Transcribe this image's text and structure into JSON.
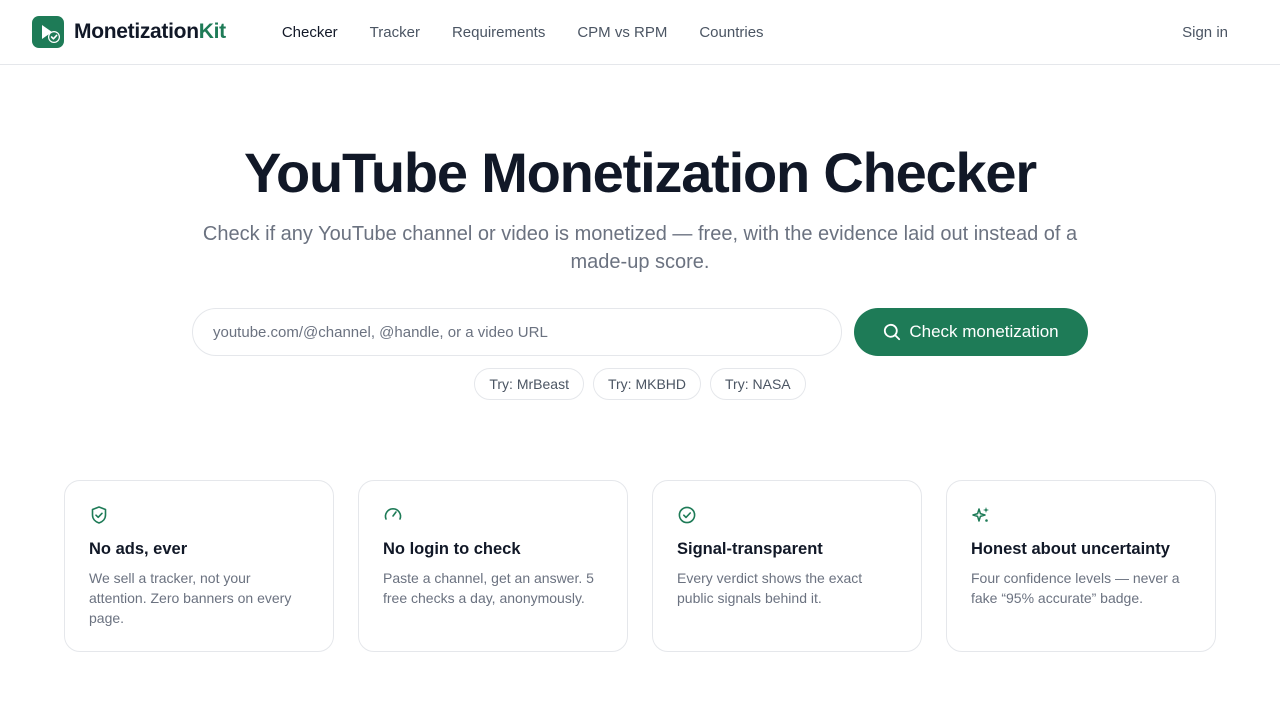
{
  "brand": {
    "name_main": "Monetization",
    "name_accent": "Kit",
    "logo_icon": "play-check-icon"
  },
  "nav": {
    "items": [
      {
        "label": "Checker",
        "active": true
      },
      {
        "label": "Tracker",
        "active": false
      },
      {
        "label": "Requirements",
        "active": false
      },
      {
        "label": "CPM vs RPM",
        "active": false
      },
      {
        "label": "Countries",
        "active": false
      }
    ],
    "signin_label": "Sign in"
  },
  "hero": {
    "title": "YouTube Monetization Checker",
    "subtitle": "Check if any YouTube channel or video is monetized — free, with the evidence laid out instead of a made-up score."
  },
  "search": {
    "placeholder": "youtube.com/@channel, @handle, or a video URL",
    "value": "",
    "button_label": "Check monetization",
    "button_icon": "search-icon"
  },
  "examples": [
    "Try: MrBeast",
    "Try: MKBHD",
    "Try: NASA"
  ],
  "features": [
    {
      "icon": "shield-check-icon",
      "title": "No ads, ever",
      "text": "We sell a tracker, not your attention. Zero banners on every page."
    },
    {
      "icon": "gauge-icon",
      "title": "No login to check",
      "text": "Paste a channel, get an answer. 5 free checks a day, anonymously."
    },
    {
      "icon": "check-circle-icon",
      "title": "Signal-transparent",
      "text": "Every verdict shows the exact public signals behind it."
    },
    {
      "icon": "sparkles-icon",
      "title": "Honest about uncertainty",
      "text": "Four confidence levels — never a fake “95% accurate” badge."
    }
  ],
  "colors": {
    "accent": "#1e7b57",
    "text": "#111827",
    "muted": "#6b7280",
    "border": "#e5e7eb"
  }
}
